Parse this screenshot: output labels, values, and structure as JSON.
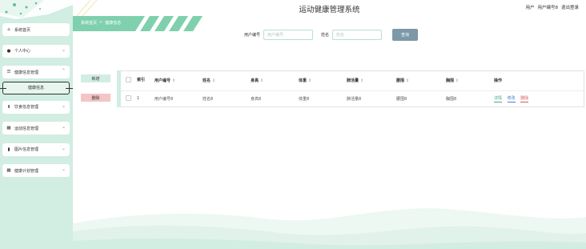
{
  "app": {
    "title": "运动健康管理系统"
  },
  "user_bar": {
    "prefix": "用户",
    "username": "用户编号8",
    "logout": "退出登录"
  },
  "breadcrumb": {
    "home": "系统首页",
    "separator": ">",
    "current": "健康信息"
  },
  "sidebar": {
    "items": [
      {
        "label": "系统首页",
        "icon": "home-icon"
      },
      {
        "label": "个人中心",
        "icon": "person-icon"
      },
      {
        "label": "健康信息管理",
        "icon": "sliders-icon"
      },
      {
        "label": "健康信息",
        "icon": ""
      },
      {
        "label": "饮食信息管理",
        "icon": "person-up-icon"
      },
      {
        "label": "运动信息管理",
        "icon": "grid-icon"
      },
      {
        "label": "图片信息管理",
        "icon": "bar-chart-icon"
      },
      {
        "label": "健康计划管理",
        "icon": "grid-icon"
      }
    ]
  },
  "search": {
    "user_no_label": "用户编号",
    "user_no_placeholder": "用户编号",
    "name_label": "姓名",
    "name_placeholder": "姓名",
    "button": "查询"
  },
  "actions": {
    "add": "新增",
    "delete": "删除"
  },
  "table": {
    "columns": [
      "索引",
      "用户编号",
      "姓名",
      "身高",
      "体重",
      "肺活量",
      "腰围",
      "胸围",
      "操作"
    ],
    "rows": [
      {
        "index": "1",
        "user_no": "用户编号8",
        "name": "姓名8",
        "height": "身高8",
        "weight": "体重8",
        "lung": "肺活量8",
        "waist": "腰围8",
        "chest": "胸围8"
      }
    ],
    "ops": {
      "detail": "详情",
      "edit": "修改",
      "delete": "删除"
    }
  },
  "colors": {
    "sidebar_bg": "#d2ede2",
    "accent": "#44a883",
    "danger": "#d85a5a",
    "search_button": "#7d98a8"
  }
}
